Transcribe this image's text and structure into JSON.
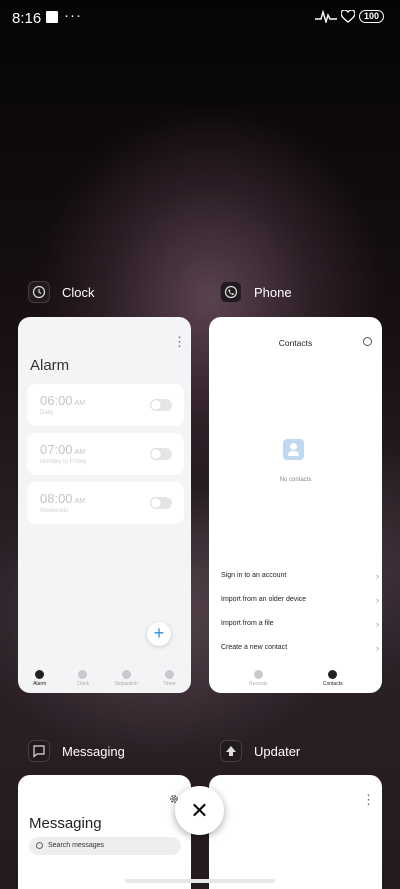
{
  "status_bar": {
    "time": "8:16",
    "dots": "···",
    "battery": "100"
  },
  "apps": {
    "clock": {
      "name": "Clock",
      "screen_title": "Alarm",
      "alarms": [
        {
          "time": "06:00",
          "ampm": "AM",
          "label": "Daily",
          "enabled": false
        },
        {
          "time": "07:00",
          "ampm": "AM",
          "label": "Monday to Friday",
          "enabled": false
        },
        {
          "time": "08:00",
          "ampm": "AM",
          "label": "Weekends",
          "enabled": false
        }
      ],
      "fab_label": "+",
      "nav": [
        "Alarm",
        "Clock",
        "Stopwatch",
        "Timer"
      ]
    },
    "phone": {
      "name": "Phone",
      "screen_title": "Contacts",
      "empty_text": "No contacts",
      "options": [
        "Sign in to an account",
        "Import from an older device",
        "Import from a file",
        "Create a new contact"
      ],
      "nav": [
        "Recents",
        "Contacts"
      ]
    },
    "messaging": {
      "name": "Messaging",
      "screen_title": "Messaging",
      "search_placeholder": "Search messages"
    },
    "updater": {
      "name": "Updater"
    }
  },
  "close_label": "✕",
  "colors": {
    "fab_accent": "#2a8de0",
    "placeholder_blue": "#bfdaf0"
  }
}
